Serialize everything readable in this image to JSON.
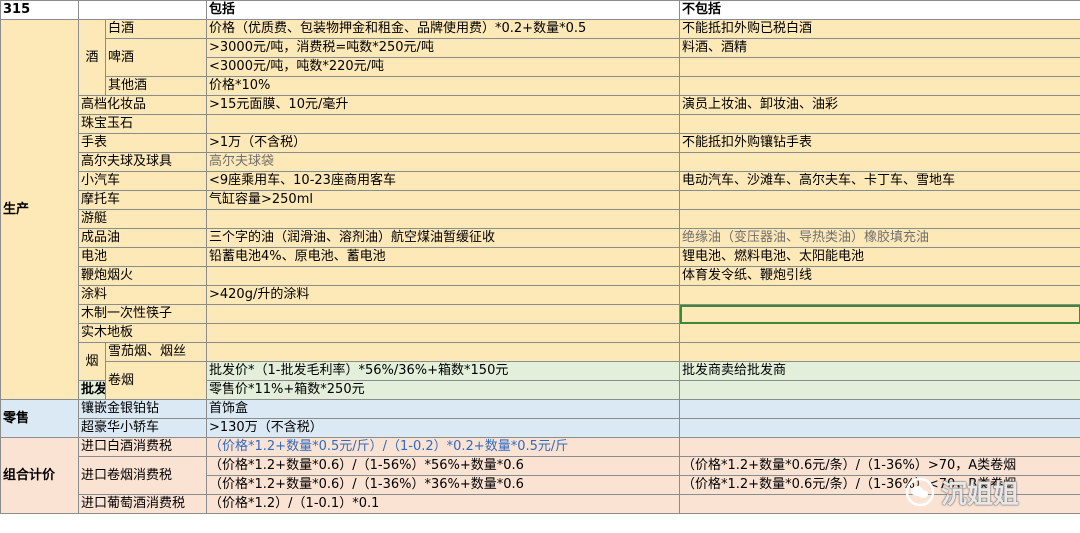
{
  "header": {
    "label": "315",
    "include": "包括",
    "exclude": "不包括"
  },
  "sections": {
    "production": "生产",
    "wholesale": "批发",
    "retail": "零售",
    "combined": "组合计价"
  },
  "subgroups": {
    "liquor": "酒",
    "tobacco": "烟"
  },
  "rows": {
    "baijiu": {
      "item": "白酒",
      "include": "价格（优质费、包装物押金和租金、品牌使用费）*0.2+数量*0.5",
      "exclude": "不能抵扣外购已税白酒"
    },
    "beer": {
      "item": "啤酒",
      "include": ">3000元/吨，消费税=吨数*250元/吨",
      "exclude": "料酒、酒精"
    },
    "beer2": {
      "include": "<3000元/吨，吨数*220元/吨",
      "exclude": ""
    },
    "other_liquor": {
      "item": "其他酒",
      "include": "价格*10%",
      "exclude": ""
    },
    "cosmetics": {
      "item": "高档化妆品",
      "include": ">15元面膜、10元/毫升",
      "exclude": "演员上妆油、卸妆油、油彩"
    },
    "jewelry": {
      "item": "珠宝玉石",
      "include": "",
      "exclude": ""
    },
    "watch": {
      "item": "手表",
      "include": ">1万（不含税）",
      "exclude": "不能抵扣外购镶钻手表"
    },
    "golf": {
      "item": "高尔夫球及球具",
      "include": "高尔夫球袋",
      "exclude": ""
    },
    "car": {
      "item": "小汽车",
      "include": "<9座乘用车、10-23座商用客车",
      "exclude": "电动汽车、沙滩车、高尔夫车、卡丁车、雪地车"
    },
    "motorcycle": {
      "item": "摩托车",
      "include": "气缸容量>250ml",
      "exclude": ""
    },
    "yacht": {
      "item": "游艇",
      "include": "",
      "exclude": ""
    },
    "oil": {
      "item": "成品油",
      "include": "三个字的油（润滑油、溶剂油）航空煤油暂缓征收",
      "exclude": "绝缘油（变压器油、导热类油）橡胶填充油"
    },
    "battery": {
      "item": "电池",
      "include": "铅蓄电池4%、原电池、蓄电池",
      "exclude": "锂电池、燃料电池、太阳能电池"
    },
    "fireworks": {
      "item": "鞭炮烟火",
      "include": "",
      "exclude": "体育发令纸、鞭炮引线"
    },
    "paint": {
      "item": "涂料",
      "include": ">420g/升的涂料",
      "exclude": ""
    },
    "chopsticks": {
      "item": "木制一次性筷子",
      "include": "",
      "exclude": ""
    },
    "floor": {
      "item": "实木地板",
      "include": "",
      "exclude": ""
    },
    "cigar": {
      "item": "雪茄烟、烟丝",
      "include": "",
      "exclude": ""
    },
    "cigarette": {
      "item": "卷烟",
      "include": "批发价*（1-批发毛利率）*56%/36%+箱数*150元",
      "exclude": "批发商卖给批发商"
    },
    "wholesale": {
      "include": "零售价*11%+箱数*250元",
      "exclude": ""
    },
    "gold": {
      "item": "镶嵌金银铂钻",
      "include": "首饰盒",
      "exclude": ""
    },
    "luxury_car": {
      "item": "超豪华小轿车",
      "include": ">130万（不含税）",
      "exclude": ""
    },
    "imp_baijiu": {
      "item": "进口白酒消费税",
      "include": "（价格*1.2+数量*0.5元/斤）/（1-0.2）*0.2+数量*0.5元/斤",
      "exclude": ""
    },
    "imp_cig": {
      "item": "进口卷烟消费税",
      "include": "（价格*1.2+数量*0.6）/（1-56%）*56%+数量*0.6",
      "exclude": "（价格*1.2+数量*0.6元/条）/（1-36%）>70，A类卷烟"
    },
    "imp_cig2": {
      "include": "（价格*1.2+数量*0.6）/（1-36%）*36%+数量*0.6",
      "exclude": "（价格*1.2+数量*0.6元/条）/（1-36%）<70，B类卷烟"
    },
    "imp_wine": {
      "item": "进口葡萄酒消费税",
      "include": "（价格*1.2）/（1-0.1）*0.1",
      "exclude": ""
    }
  },
  "watermark": {
    "text": "沉姐姐",
    "icon": "wechat-icon"
  }
}
